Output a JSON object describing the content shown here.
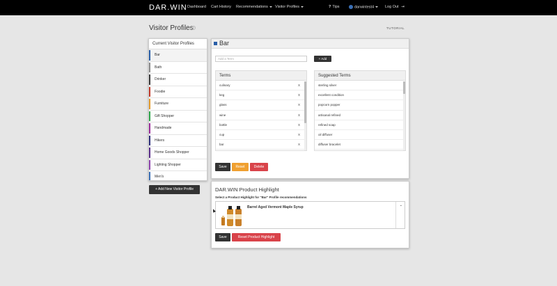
{
  "nav": {
    "brand": "DAR.WIN",
    "links": [
      "Dashboard",
      "Cart History",
      "Recommendations",
      "Visitor Profiles"
    ],
    "tips": "Tips",
    "user": "darwintest4",
    "logout": "Log Out"
  },
  "page": {
    "title": "Visitor Profiles",
    "tutorial": "TUTORIAL"
  },
  "profiles": {
    "header": "Current Visitor Profiles",
    "items": [
      {
        "label": "Bar",
        "color": "#2a5fa8"
      },
      {
        "label": "Bath",
        "color": "#8a8a8a"
      },
      {
        "label": "Drinker",
        "color": "#3a3a3a"
      },
      {
        "label": "Foodie",
        "color": "#c0392b"
      },
      {
        "label": "Furniture",
        "color": "#e39a2a"
      },
      {
        "label": "Gift Shopper",
        "color": "#2ea64a"
      },
      {
        "label": "Handmade",
        "color": "#9b2d9b"
      },
      {
        "label": "Hikers",
        "color": "#2d2f7a"
      },
      {
        "label": "Home Goods Shopper",
        "color": "#5a2d8a"
      },
      {
        "label": "Lighting Shopper",
        "color": "#8e44ad"
      },
      {
        "label": "Men's",
        "color": "#3a6fb5"
      }
    ],
    "add_button": "+ Add New Visitor Profile"
  },
  "profile_editor": {
    "title": "Bar",
    "term_placeholder": "Add a Term",
    "add_button": "+ Add",
    "terms_header": "Terms",
    "terms": [
      "culinary",
      "keg",
      "glass",
      "wine",
      "bottle",
      "cup",
      "bar"
    ],
    "remove_label": "X",
    "suggested_header": "Suggested Terms",
    "suggested": [
      "sterling silver",
      "excellent condition",
      "popcorn popper",
      "artisanal refined",
      "refined soap",
      "oil diffuser",
      "diffuser bracelet"
    ],
    "save": "Save",
    "reset": "Reset",
    "delete": "Delete"
  },
  "product_highlight": {
    "title": "DAR.WIN Product Highlight",
    "subtitle": "Select a Product Highlight for \"Bar\" Profile recommendations",
    "product": "Barrel Aged Vermont Maple Syrup",
    "save": "Save",
    "reset": "Reset Product Highlight"
  },
  "colors": {
    "dark": "#333333",
    "orange": "#f0a030",
    "red": "#d9434a",
    "accent": "#2a5fa8"
  }
}
